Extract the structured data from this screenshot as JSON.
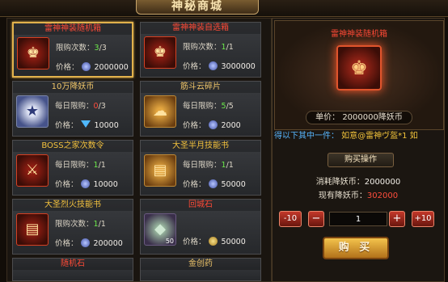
{
  "window": {
    "title": "神秘商城"
  },
  "labels": {
    "limit": "限购次数：",
    "daily_limit": "每日限购：",
    "price": "价格："
  },
  "items": [
    {
      "name": "雷神神装随机箱",
      "limit_label": "限购次数：",
      "used": "3",
      "total": "/3",
      "price": "2000000",
      "currency": "coin-icon",
      "icon": "thunder-god-chest-icon",
      "qty": ""
    },
    {
      "name": "雷神神装自选箱",
      "limit_label": "限购次数：",
      "used": "1",
      "total": "/1",
      "price": "3000000",
      "currency": "coin-icon",
      "icon": "thunder-god-select-chest-icon",
      "qty": ""
    },
    {
      "name": "10万降妖币",
      "limit_label": "每日限购：",
      "used": "0",
      "total": "/3",
      "price": "10000",
      "currency": "diamond-icon",
      "icon": "demon-coin-icon",
      "qty": ""
    },
    {
      "name": "筋斗云碎片",
      "limit_label": "每日限购：",
      "used": "5",
      "total": "/5",
      "price": "2000",
      "currency": "coin-icon",
      "icon": "cloud-fragment-icon",
      "qty": ""
    },
    {
      "name": "BOSS之家次数令",
      "limit_label": "每日限购：",
      "used": "1",
      "total": "/1",
      "price": "10000",
      "currency": "coin-icon",
      "icon": "boss-home-token-icon",
      "qty": ""
    },
    {
      "name": "大圣半月技能书",
      "limit_label": "每日限购：",
      "used": "1",
      "total": "/1",
      "price": "50000",
      "currency": "coin-icon",
      "icon": "skill-book-icon",
      "qty": ""
    },
    {
      "name": "大圣烈火技能书",
      "limit_label": "限购次数：",
      "used": "1",
      "total": "/1",
      "price": "200000",
      "currency": "coin-icon",
      "icon": "fire-skill-book-icon",
      "qty": ""
    },
    {
      "name": "回城石",
      "limit_label": "",
      "used": "",
      "total": "",
      "price": "50000",
      "currency": "gold-coin-icon",
      "icon": "return-stone-icon",
      "qty": "50"
    },
    {
      "name": "随机石",
      "limit_label": "",
      "used": "",
      "total": "",
      "price": "",
      "currency": "",
      "icon": "",
      "qty": ""
    },
    {
      "name": "金创药",
      "limit_label": "",
      "used": "",
      "total": "",
      "price": "",
      "currency": "",
      "icon": "",
      "qty": ""
    }
  ],
  "selected": {
    "name": "雷神神装随机箱",
    "unit_price": "单价：  2000000降妖币",
    "ticker_prefix": "得以下其中一件：",
    "ticker_item": "  如意@雷神ヴ盔*1  如"
  },
  "purchase": {
    "header": "购买操作",
    "cost_label": "消耗降妖币：",
    "cost_value": "2000000",
    "owned_label": "现有降妖币：",
    "owned_value": "302000",
    "minus10": "-10",
    "minus": "−",
    "quantity": "1",
    "plus": "+",
    "plus10": "+10",
    "buy_label": "购 买"
  },
  "colors": {
    "selected_border": "#e2b24c",
    "item_name_red": "#ff4a36",
    "limit_ok": "#6ce84b",
    "limit_zero": "#ff4d3c",
    "ticker_blue": "#58b7ff"
  }
}
